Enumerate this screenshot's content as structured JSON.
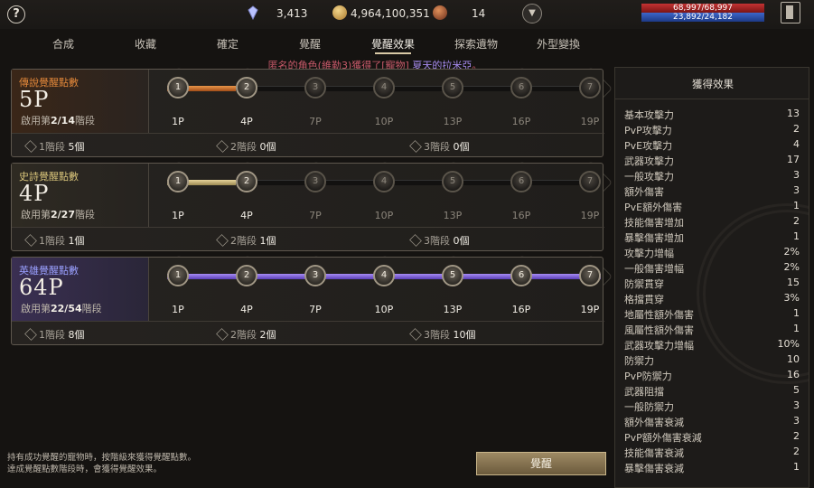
{
  "topbar": {
    "help_icon": "?",
    "gems": "3,413",
    "gold": "4,964,100,351",
    "tokens": "14",
    "hp": "68,997/68,997",
    "mp": "23,892/24,182"
  },
  "tabs": [
    "合成",
    "收藏",
    "確定",
    "覺醒",
    "覺醒效果",
    "探索遺物",
    "外型變換"
  ],
  "active_tab": "覺醒效果",
  "notice": {
    "prefix": "匿名的角色(維勒3)獲得了[寵物] ",
    "highlight": "夏天的拉米亞",
    "suffix": "。"
  },
  "panels": [
    {
      "title": "傳說覺醒點數",
      "points": "5P",
      "unlock_prefix": "啟用第",
      "unlock_value": "2/14",
      "unlock_suffix": "階段",
      "progress": 0.158,
      "nodes": [
        "1",
        "2",
        "3",
        "4",
        "5",
        "6",
        "7"
      ],
      "active_nodes": 2,
      "labels": [
        "1P",
        "4P",
        "7P",
        "10P",
        "13P",
        "16P",
        "19P"
      ],
      "stage1": "1階段",
      "stage1_count": "5個",
      "stage2": "2階段",
      "stage2_count": "0個",
      "stage3": "3階段",
      "stage3_count": "0個"
    },
    {
      "title": "史詩覺醒點數",
      "points": "4P",
      "unlock_prefix": "啟用第",
      "unlock_value": "2/27",
      "unlock_suffix": "階段",
      "progress": 0.158,
      "nodes": [
        "1",
        "2",
        "3",
        "4",
        "5",
        "6",
        "7"
      ],
      "active_nodes": 2,
      "labels": [
        "1P",
        "4P",
        "7P",
        "10P",
        "13P",
        "16P",
        "19P"
      ],
      "stage1": "1階段",
      "stage1_count": "1個",
      "stage2": "2階段",
      "stage2_count": "1個",
      "stage3": "3階段",
      "stage3_count": "0個"
    },
    {
      "title": "英雄覺醒點數",
      "points": "64P",
      "unlock_prefix": "啟用第",
      "unlock_value": "22/54",
      "unlock_suffix": "階段",
      "progress": 1.0,
      "nodes": [
        "1",
        "2",
        "3",
        "4",
        "5",
        "6",
        "7"
      ],
      "active_nodes": 7,
      "labels": [
        "1P",
        "4P",
        "7P",
        "10P",
        "13P",
        "16P",
        "19P"
      ],
      "stage1": "1階段",
      "stage1_count": "8個",
      "stage2": "2階段",
      "stage2_count": "2個",
      "stage3": "3階段",
      "stage3_count": "10個"
    }
  ],
  "footer": {
    "hint_line1": "持有成功覺醒的寵物時，按階級來獲得覺醒點數。",
    "hint_line2": "達成覺醒點數階段時，會獲得覺醒效果。",
    "awaken_button": "覺醒"
  },
  "effects": {
    "title": "獲得效果",
    "items": [
      {
        "name": "基本攻擊力",
        "value": "13"
      },
      {
        "name": "PvP攻擊力",
        "value": "2"
      },
      {
        "name": "PvE攻擊力",
        "value": "4"
      },
      {
        "name": "武器攻擊力",
        "value": "17"
      },
      {
        "name": "一般攻擊力",
        "value": "3"
      },
      {
        "name": "額外傷害",
        "value": "3"
      },
      {
        "name": "PvE額外傷害",
        "value": "1"
      },
      {
        "name": "技能傷害增加",
        "value": "2"
      },
      {
        "name": "暴擊傷害增加",
        "value": "1"
      },
      {
        "name": "攻擊力增幅",
        "value": "2%"
      },
      {
        "name": "一般傷害增幅",
        "value": "2%"
      },
      {
        "name": "防禦貫穿",
        "value": "15"
      },
      {
        "name": "格擋貫穿",
        "value": "3%"
      },
      {
        "name": "地屬性額外傷害",
        "value": "1"
      },
      {
        "name": "風屬性額外傷害",
        "value": "1"
      },
      {
        "name": "武器攻擊力增幅",
        "value": "10%"
      },
      {
        "name": "防禦力",
        "value": "10"
      },
      {
        "name": "PvP防禦力",
        "value": "16"
      },
      {
        "name": "武器阻擋",
        "value": "5"
      },
      {
        "name": "一般防禦力",
        "value": "3"
      },
      {
        "name": "額外傷害衰減",
        "value": "3"
      },
      {
        "name": "PvP額外傷害衰減",
        "value": "2"
      },
      {
        "name": "技能傷害衰減",
        "value": "2"
      },
      {
        "name": "暴擊傷害衰減",
        "value": "1"
      }
    ]
  },
  "colors": {
    "legend": "#e3883a",
    "epic": "#d8c47a",
    "hero": "#9aa0ff",
    "notice": "#c85a6a",
    "hp": "#c23232",
    "mp": "#3d66c9"
  }
}
